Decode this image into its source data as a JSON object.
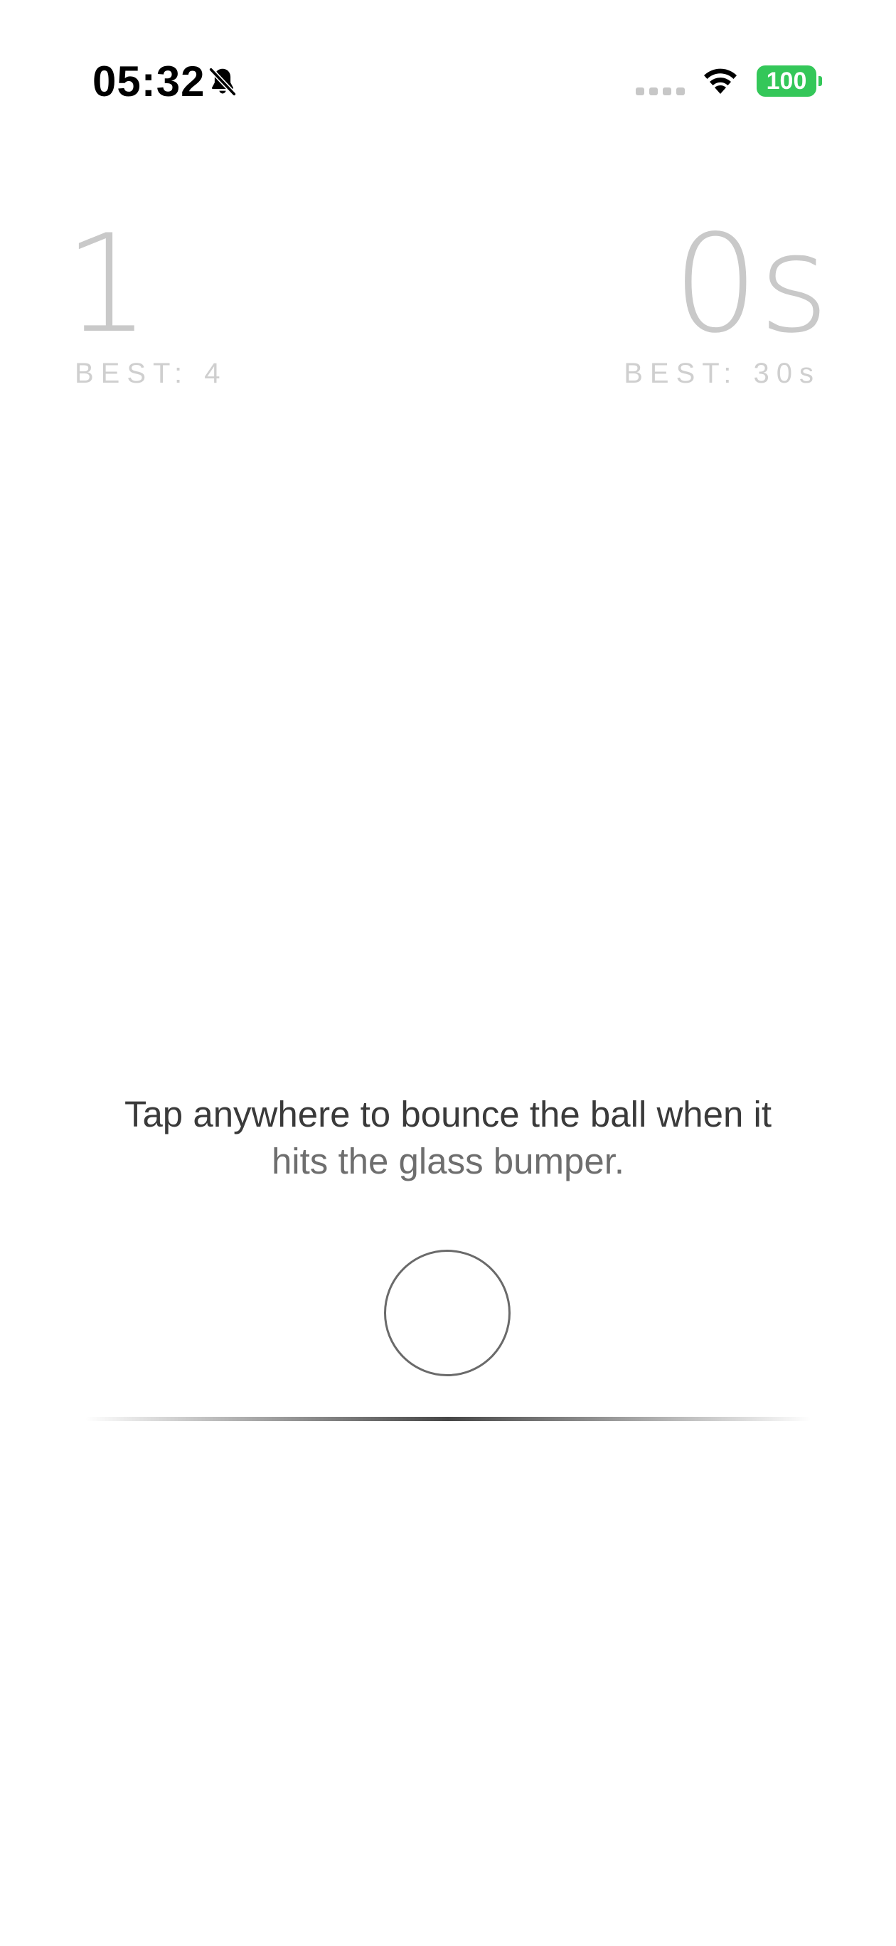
{
  "status_bar": {
    "time": "05:32",
    "battery_level": "100",
    "battery_color": "#34c759"
  },
  "score": {
    "current_score": "1",
    "best_score_label": "BEST: 4",
    "current_time": "0s",
    "best_time_label": "BEST: 30s"
  },
  "instructions": {
    "line1": "Tap anywhere to bounce the ball when it",
    "line2": "hits the glass bumper."
  },
  "icons": {
    "bell": "bell-slash-icon",
    "signal": "cellular-signal-icon",
    "wifi": "wifi-icon",
    "battery": "battery-icon"
  }
}
